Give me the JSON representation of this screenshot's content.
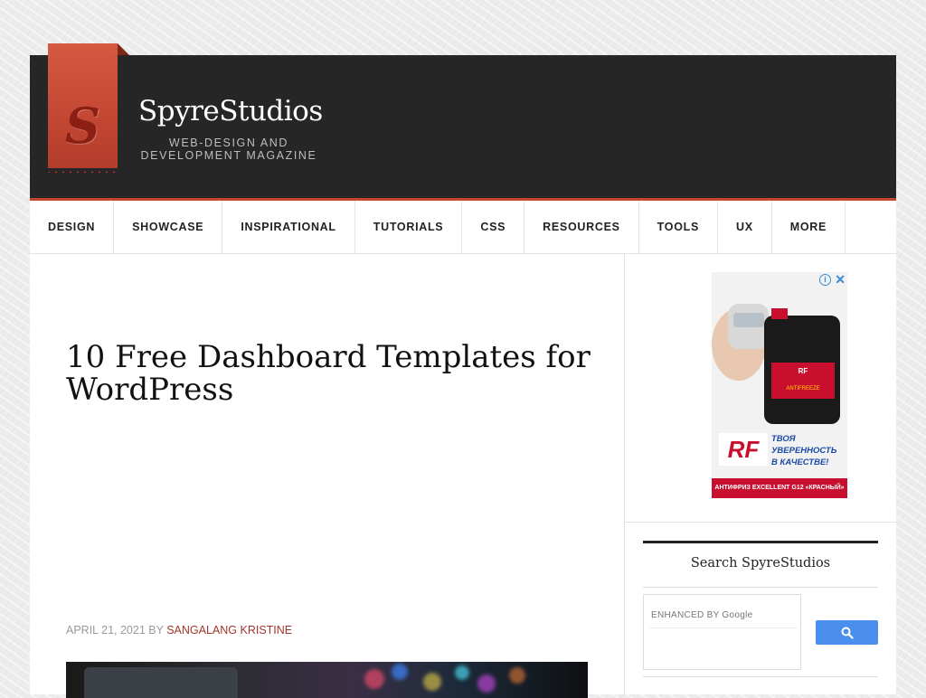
{
  "site": {
    "logo_letter": "S",
    "title": "SpyreStudios",
    "tagline": "WEB-DESIGN AND DEVELOPMENT MAGAZINE"
  },
  "nav": {
    "items": [
      {
        "label": "DESIGN"
      },
      {
        "label": "SHOWCASE"
      },
      {
        "label": "INSPIRATIONAL"
      },
      {
        "label": "TUTORIALS"
      },
      {
        "label": "CSS"
      },
      {
        "label": "RESOURCES"
      },
      {
        "label": "TOOLS"
      },
      {
        "label": "UX"
      },
      {
        "label": "MORE"
      }
    ]
  },
  "post": {
    "title": "10 Free Dashboard Templates for WordPress",
    "date": "APRIL 21, 2021",
    "by": "BY",
    "author": "SANGALANG KRISTINE"
  },
  "ad": {
    "info_icon": "info-icon",
    "close_icon": "close-icon",
    "brand_text": "ТВОЯ УВЕРЕННОСТЬ В КАЧЕСТВЕ!",
    "footer_text": "АНТИФРИЗ EXCELLENT G12 «КРАСНЫЙ»"
  },
  "sidebar": {
    "search_title": "Search SpyreStudios",
    "search_placeholder": "ENHANCED BY Google",
    "search_button_icon": "search-icon"
  },
  "colors": {
    "accent": "#c4472f",
    "header_bg": "#262626",
    "link": "#a3342a",
    "search_button": "#4a8fed"
  }
}
